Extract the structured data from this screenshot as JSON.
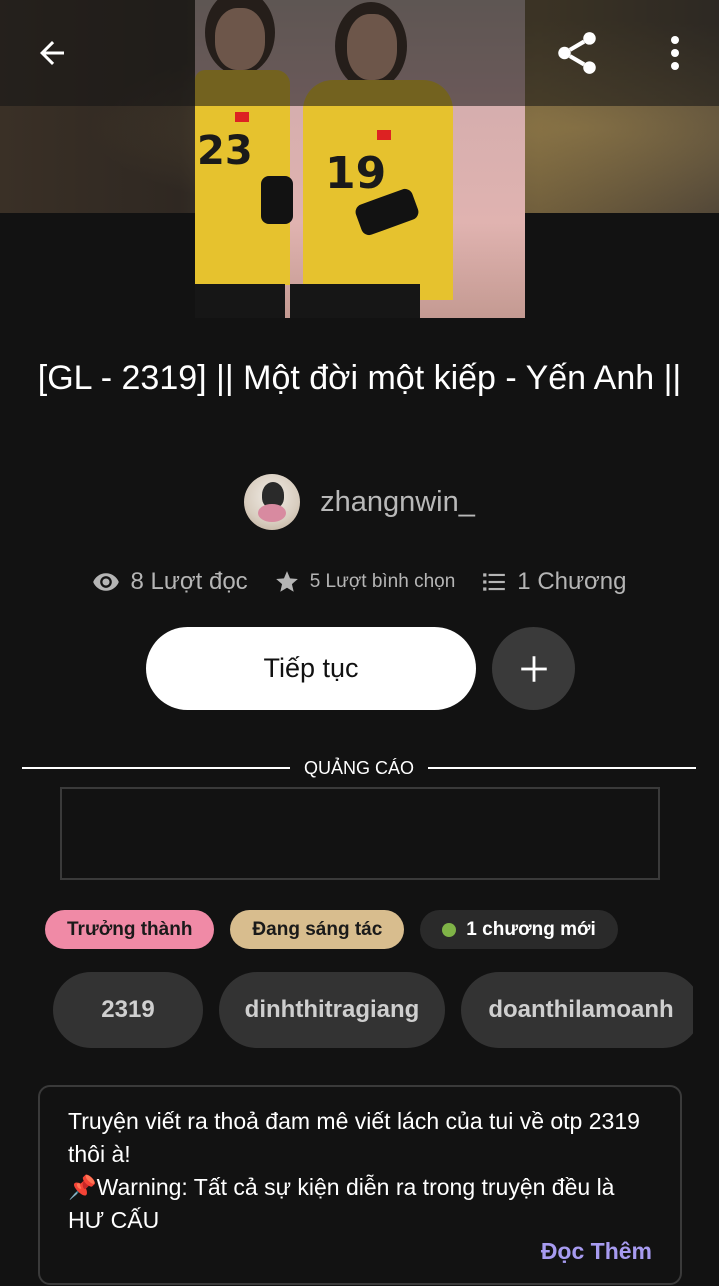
{
  "story": {
    "title": "[GL - 2319] || Một đời một kiếp - Yến Anh ||",
    "author": "zhangnwin_"
  },
  "stats": {
    "reads": "8 Lượt đọc",
    "votes": "5 Lượt bình chọn",
    "chapters": "1 Chương"
  },
  "actions": {
    "continue_label": "Tiếp tục"
  },
  "ad": {
    "label": "QUẢNG CÁO"
  },
  "badges": {
    "mature": "Trưởng thành",
    "ongoing": "Đang sáng tác",
    "new_chapter": "1 chương mới"
  },
  "tags": [
    "2319",
    "dinhthitragiang",
    "doanthilamoanh"
  ],
  "description": {
    "text": "Truyện viết ra thoả đam mê viết lách của tui về otp 2319 thôi à!\n📌Warning: Tất cả sự kiện diễn ra trong truyện đều là HƯ CẤU",
    "read_more": "Đọc Thêm"
  },
  "cover": {
    "jersey_numbers": [
      "23",
      "19"
    ]
  },
  "colors": {
    "background": "#121212",
    "badge_mature": "#f08aa6",
    "badge_ongoing": "#d8bd8e",
    "new_dot": "#7fb347",
    "read_more": "#a79bf0"
  },
  "icons": {
    "back": "arrow-left-icon",
    "share": "share-icon",
    "more": "more-vertical-icon",
    "reads": "eye-icon",
    "votes": "star-icon",
    "chapters": "list-icon",
    "add": "plus-icon"
  }
}
